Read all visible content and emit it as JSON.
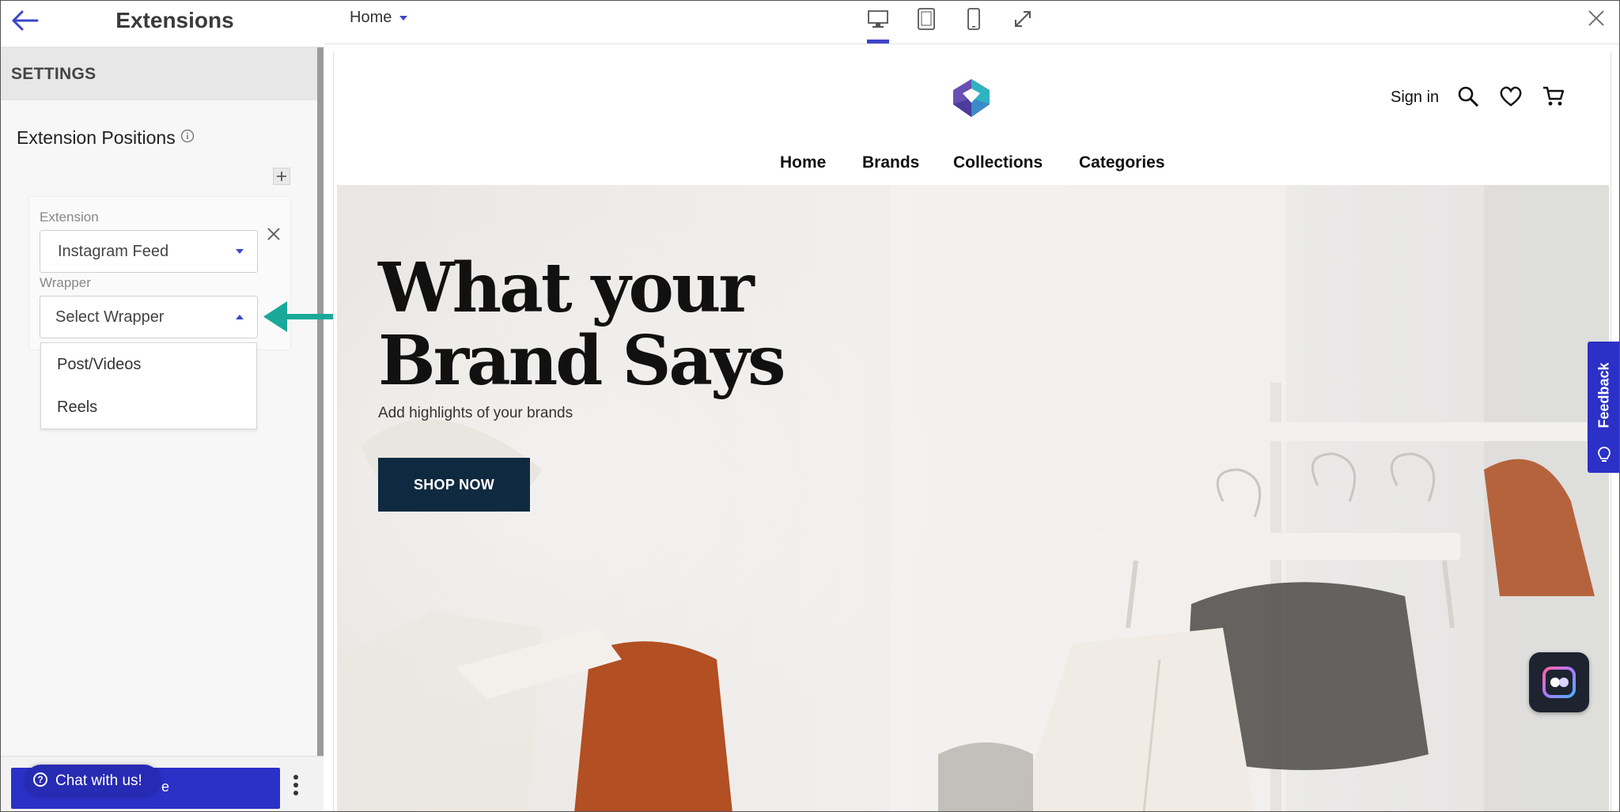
{
  "sidebar": {
    "title": "Extensions",
    "settings_label": "SETTINGS",
    "section_title": "Extension Positions",
    "extension_label": "Extension",
    "extension_value": "Instagram Feed",
    "wrapper_label": "Wrapper",
    "wrapper_placeholder": "Select Wrapper",
    "wrapper_options": [
      "Post/Videos",
      "Reels"
    ],
    "primary_button_visible_fragment": "e",
    "chat_label": "Chat with us!"
  },
  "topbar": {
    "page_select_value": "Home",
    "devices": [
      "desktop-icon",
      "tablet-icon",
      "mobile-icon",
      "expand-icon"
    ],
    "active_device": "desktop"
  },
  "preview": {
    "header": {
      "signin": "Sign in",
      "nav": [
        "Home",
        "Brands",
        "Collections",
        "Categories"
      ]
    },
    "hero": {
      "title": "What your Brand Says",
      "subtitle": "Add highlights of your brands",
      "cta": "SHOP NOW"
    },
    "feedback_label": "Feedback"
  },
  "colors": {
    "accent": "#2b30c7",
    "annotation_arrow": "#1aa89a",
    "cta_background": "#0f2a40"
  }
}
